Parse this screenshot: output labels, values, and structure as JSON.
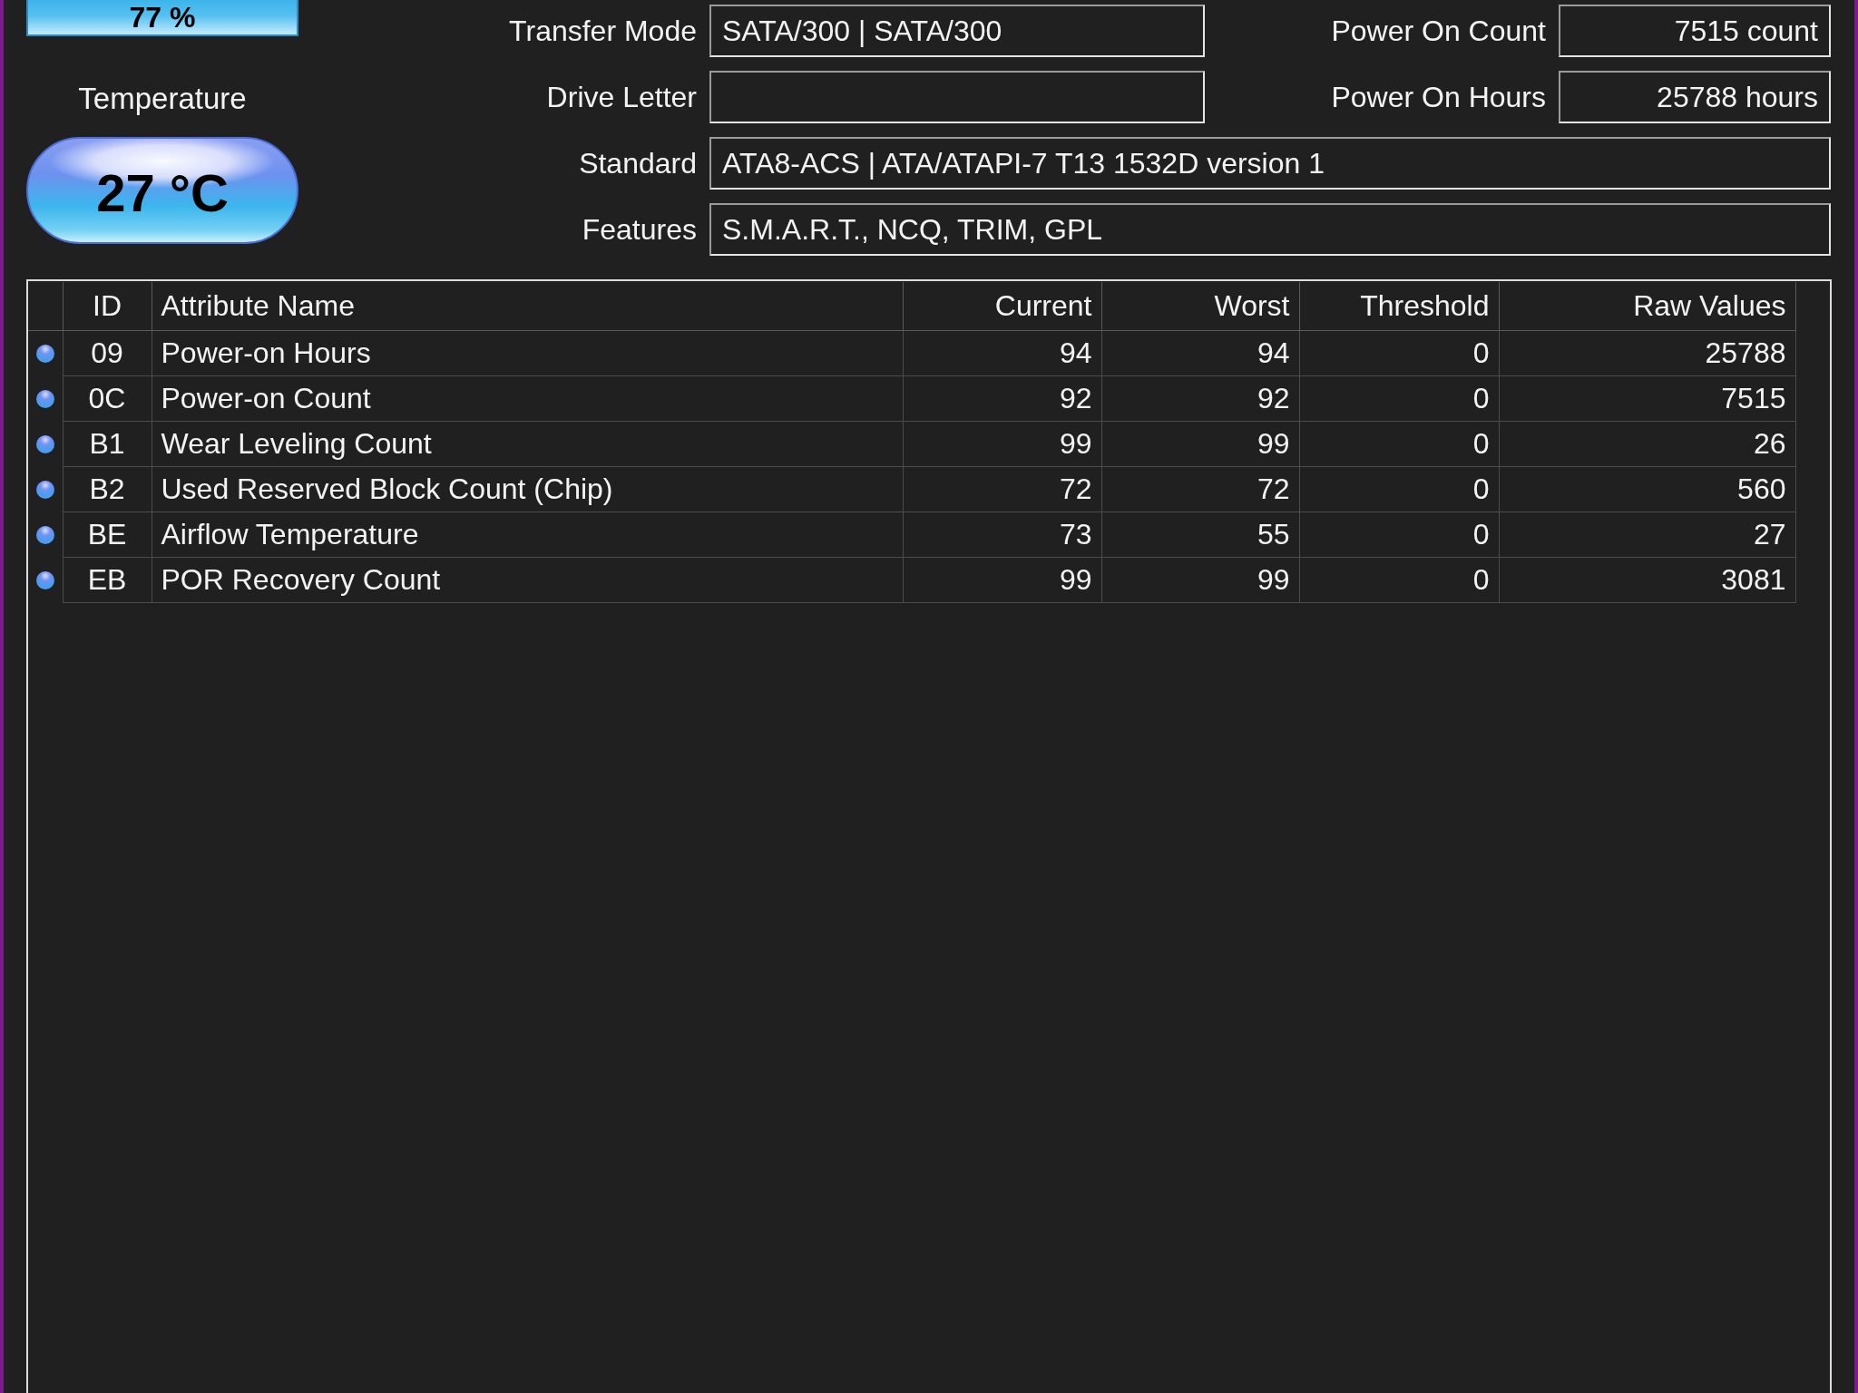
{
  "health": {
    "value": "77 %"
  },
  "temperature": {
    "label": "Temperature",
    "value": "27 °C"
  },
  "details": [
    {
      "label": "Transfer Mode",
      "value": "SATA/300 | SATA/300"
    },
    {
      "label": "Drive Letter"
    },
    {
      "label": "Standard",
      "value": "ATA8-ACS | ATA/ATAPI-7 T13 1532D version 1"
    },
    {
      "label": "Features",
      "value": "S.M.A.R.T., NCQ, TRIM, GPL"
    }
  ],
  "counters": [
    {
      "label": "Power On Count",
      "value": "7515 count"
    },
    {
      "label": "Power On Hours",
      "value": "25788 hours"
    }
  ],
  "smart_table": {
    "columns": [
      "ID",
      "Attribute Name",
      "Current",
      "Worst",
      "Threshold",
      "Raw Values"
    ],
    "rows": [
      {
        "color": "#4c9cf0",
        "id": "09",
        "name": "Power-on Hours",
        "current": "94",
        "worst": "94",
        "threshold": "0",
        "raw": "25788"
      },
      {
        "color": "#4c9cf0",
        "id": "0C",
        "name": "Power-on Count",
        "current": "92",
        "worst": "92",
        "threshold": "0",
        "raw": "7515"
      },
      {
        "color": "#4c9cf0",
        "id": "B1",
        "name": "Wear Leveling Count",
        "current": "99",
        "worst": "99",
        "threshold": "0",
        "raw": "26"
      },
      {
        "color": "#4c9cf0",
        "id": "B2",
        "name": "Used Reserved Block Count (Chip)",
        "current": "72",
        "worst": "72",
        "threshold": "0",
        "raw": "560"
      },
      {
        "color": "#4c9cf0",
        "id": "BE",
        "name": "Airflow Temperature",
        "current": "73",
        "worst": "55",
        "threshold": "0",
        "raw": "27"
      },
      {
        "color": "#4c9cf0",
        "id": "EB",
        "name": "POR Recovery Count",
        "current": "99",
        "worst": "99",
        "threshold": "0",
        "raw": "3081"
      }
    ]
  }
}
